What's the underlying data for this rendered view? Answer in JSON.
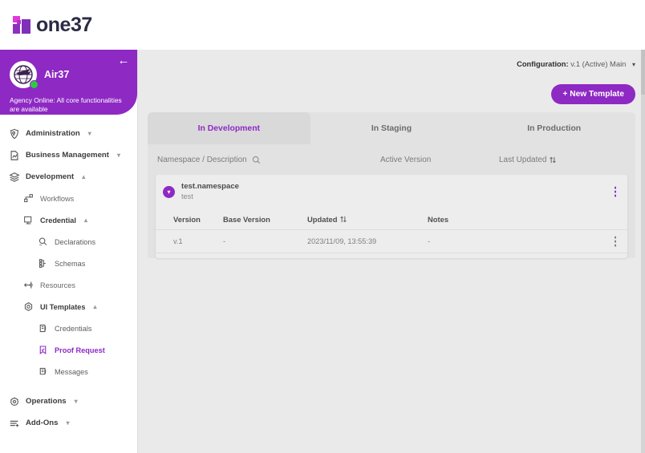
{
  "brand": {
    "name": "one37"
  },
  "sidebar": {
    "collapse_icon": "arrow-left-icon",
    "agency": {
      "name": "Air37",
      "status": "Agency Online: All core functionalities are available",
      "avatar_icon": "airplane-globe-icon",
      "presence": "online"
    },
    "items": [
      {
        "label": "Administration",
        "icon": "shield-key-icon",
        "level": 1,
        "caret": "chevron-down",
        "active": false
      },
      {
        "label": "Business Management",
        "icon": "chart-doc-icon",
        "level": 1,
        "caret": "chevron-down",
        "active": false
      },
      {
        "label": "Development",
        "icon": "layers-icon",
        "level": 1,
        "caret": "chevron-up",
        "active": false
      },
      {
        "label": "Workflows",
        "icon": "workflow-icon",
        "level": 2,
        "caret": "",
        "active": false
      },
      {
        "label": "Credential",
        "icon": "credential-icon",
        "level": 2,
        "caret": "chevron-up",
        "active": false
      },
      {
        "label": "Declarations",
        "icon": "magnifier-icon",
        "level": 3,
        "caret": "",
        "active": false
      },
      {
        "label": "Schemas",
        "icon": "schema-tree-icon",
        "level": 3,
        "caret": "",
        "active": false
      },
      {
        "label": "Resources",
        "icon": "resources-icon",
        "level": 2,
        "caret": "",
        "active": false
      },
      {
        "label": "UI Templates",
        "icon": "ui-templates-icon",
        "level": 2,
        "caret": "chevron-up",
        "active": false
      },
      {
        "label": "Credentials",
        "icon": "card-stack-icon",
        "level": 3,
        "caret": "",
        "active": false
      },
      {
        "label": "Proof Request",
        "icon": "bookmark-check-icon",
        "level": 3,
        "caret": "",
        "active": true
      },
      {
        "label": "Messages",
        "icon": "message-box-icon",
        "level": 3,
        "caret": "",
        "active": false
      },
      {
        "label": "Operations",
        "icon": "operations-icon",
        "level": 1,
        "caret": "chevron-down",
        "active": false
      },
      {
        "label": "Add-Ons",
        "icon": "addons-icon",
        "level": 1,
        "caret": "chevron-down",
        "active": false
      }
    ]
  },
  "topbar": {
    "configuration_label": "Configuration:",
    "configuration_value": "v.1 (Active) Main",
    "configuration_caret": "chevron-down-icon",
    "new_template_button": "+ New Template"
  },
  "tabs": [
    {
      "label": "In Development",
      "active": true
    },
    {
      "label": "In Staging",
      "active": false
    },
    {
      "label": "In Production",
      "active": false
    }
  ],
  "columns": {
    "namespace": "Namespace / Description",
    "search_icon": "search-icon",
    "active_version": "Active Version",
    "last_updated": "Last Updated",
    "sort_icon": "sort-arrows-icon"
  },
  "groups": [
    {
      "namespace": "test.namespace",
      "description": "test",
      "expander_icon": "chevron-down-icon",
      "menu_icon": "kebab-menu-icon",
      "subtable": {
        "headers": {
          "version": "Version",
          "base_version": "Base Version",
          "updated": "Updated",
          "updated_sort_icon": "sort-arrows-icon",
          "notes": "Notes"
        },
        "rows": [
          {
            "version": "v.1",
            "base_version": "-",
            "updated": "2023/11/09, 13:55:39",
            "notes": "-",
            "menu_icon": "kebab-menu-icon"
          }
        ]
      }
    }
  ],
  "colors": {
    "brand_purple": "#8e29c4",
    "accent_magenta": "#e03ad8",
    "online_green": "#2ecb3f",
    "page_bg": "#eaeaea",
    "card_bg": "#e2e2e2"
  }
}
